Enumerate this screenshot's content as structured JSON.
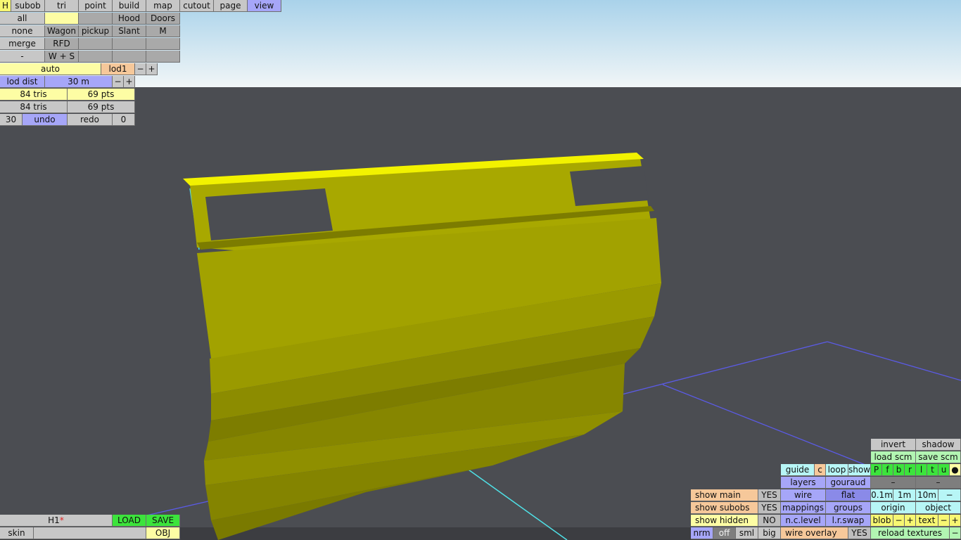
{
  "colors": {
    "sky_top": "#a9d2ea",
    "sky_bottom": "#f1f6f7",
    "background": "#4b4d52",
    "model_face": "#a8a800",
    "model_top_edge": "#f2f200",
    "grid_line": "#5b5be6",
    "axis_line": "#4fe0e6"
  },
  "toolbar_top": {
    "h": "H",
    "tabs": [
      "subob",
      "tri",
      "point",
      "build",
      "map",
      "cutout",
      "page",
      "view"
    ],
    "active_tab": "view"
  },
  "select_grid": {
    "row1": [
      "all",
      "",
      "",
      "Hood",
      "Doors"
    ],
    "row2": [
      "none",
      "Wagon",
      "pickup",
      "Slant",
      "M"
    ],
    "row3": [
      "merge",
      "RFD",
      "",
      "",
      ""
    ],
    "row4": [
      "-",
      "W + S",
      "",
      "",
      ""
    ]
  },
  "lod": {
    "mode": "auto",
    "level": "lod1",
    "minus": "−",
    "plus": "+",
    "dist_label": "lod dist",
    "dist_value": "30 m",
    "dist_minus": "−",
    "dist_plus": "+"
  },
  "stats": {
    "tris_1": "84 tris",
    "pts_1": "69 pts",
    "tris_2": "84 tris",
    "pts_2": "69 pts"
  },
  "history": {
    "count": "30",
    "undo": "undo",
    "redo": "redo",
    "redo_count": "0"
  },
  "file_panel": {
    "name": "H1",
    "modified_mark": "*",
    "load": "LOAD",
    "save": "SAVE",
    "skin": "skin",
    "obj": "OBJ"
  },
  "view_panel": {
    "invert": "invert",
    "shadow": "shadow",
    "load_scm": "load scm",
    "save_scm": "save scm",
    "guide": "guide",
    "c": "c",
    "loop": "loop",
    "show": "show",
    "pfbrltu": [
      "P",
      "f",
      "b",
      "r",
      "l",
      "t",
      "u"
    ],
    "dot": "●",
    "layers": "layers",
    "gouraud": "gouraud",
    "dash1": "–",
    "dash2": "–",
    "wire": "wire",
    "flat": "flat",
    "step_01": "0.1m",
    "step_1": "1m",
    "step_10": "10m",
    "step_minus": "−",
    "mappings": "mappings",
    "groups": "groups",
    "origin": "origin",
    "object": "object",
    "nc_level": "n.c.level",
    "lr_swap": "l.r.swap",
    "blob": "blob",
    "blob_minus": "−",
    "blob_plus": "+",
    "text": "text",
    "text_minus": "−",
    "text_plus": "+",
    "show_main": "show main",
    "show_main_val": "YES",
    "show_subobs": "show subobs",
    "show_subobs_val": "YES",
    "show_hidden": "show hidden",
    "show_hidden_val": "NO",
    "wire_overlay": "wire overlay",
    "wire_overlay_val": "YES",
    "reload_textures": "reload textures",
    "reload_minus": "−",
    "nrm": "nrm",
    "off": "off",
    "sml": "sml",
    "big": "big"
  }
}
